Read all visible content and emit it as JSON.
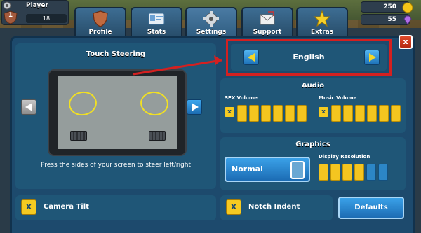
{
  "player": {
    "name": "Player",
    "level": "18",
    "rank": "1"
  },
  "currency": {
    "coins": "250",
    "gems": "55"
  },
  "tabs": [
    {
      "label": "Profile",
      "icon": "shield-icon",
      "active": false
    },
    {
      "label": "Stats",
      "icon": "id-card-icon",
      "active": false
    },
    {
      "label": "Settings",
      "icon": "gear-icon",
      "active": true
    },
    {
      "label": "Support",
      "icon": "envelope-icon",
      "active": false
    },
    {
      "label": "Extras",
      "icon": "star-icon",
      "active": false
    }
  ],
  "close_label": "x",
  "steering": {
    "title": "Touch Steering",
    "description": "Press the sides of your screen to steer left/right"
  },
  "language": {
    "value": "English"
  },
  "audio": {
    "title": "Audio",
    "sfx_label": "SFX Volume",
    "sfx_level": 6,
    "music_label": "Music Volume",
    "music_level": 6,
    "segments": 6
  },
  "graphics": {
    "title": "Graphics",
    "quality": "Normal",
    "resolution_label": "Display Resolution",
    "resolution_level": 4,
    "resolution_segments": 6
  },
  "camera_tilt": {
    "label": "Camera Tilt",
    "checked": true
  },
  "notch_indent": {
    "label": "Notch Indent",
    "checked": true
  },
  "defaults_label": "Defaults",
  "colors": {
    "panel": "#1d4a6d",
    "card": "#1f5677",
    "accent_yellow": "#f5cb21",
    "highlight_red": "#d42020",
    "button_blue": "#2a8ad4"
  }
}
